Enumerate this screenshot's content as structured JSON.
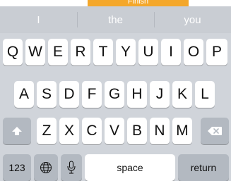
{
  "banner": {
    "label": "Finish"
  },
  "suggestions": [
    "I",
    "the",
    "you"
  ],
  "rows": [
    [
      "Q",
      "W",
      "E",
      "R",
      "T",
      "Y",
      "U",
      "I",
      "O",
      "P"
    ],
    [
      "A",
      "S",
      "D",
      "F",
      "G",
      "H",
      "J",
      "K",
      "L"
    ],
    [
      "Z",
      "X",
      "C",
      "V",
      "B",
      "N",
      "M"
    ]
  ],
  "bottom": {
    "numbers": "123",
    "space": "space",
    "return": "return"
  },
  "icons": {
    "shift": "shift-arrow-icon",
    "delete": "backspace-icon",
    "globe": "globe-icon",
    "mic": "microphone-icon"
  },
  "colors": {
    "accent": "#f4a72a",
    "keyboard_bg": "#d0d4da",
    "suggestion_bg": "#c9cdd3",
    "special_key": "#b3b9c1"
  }
}
